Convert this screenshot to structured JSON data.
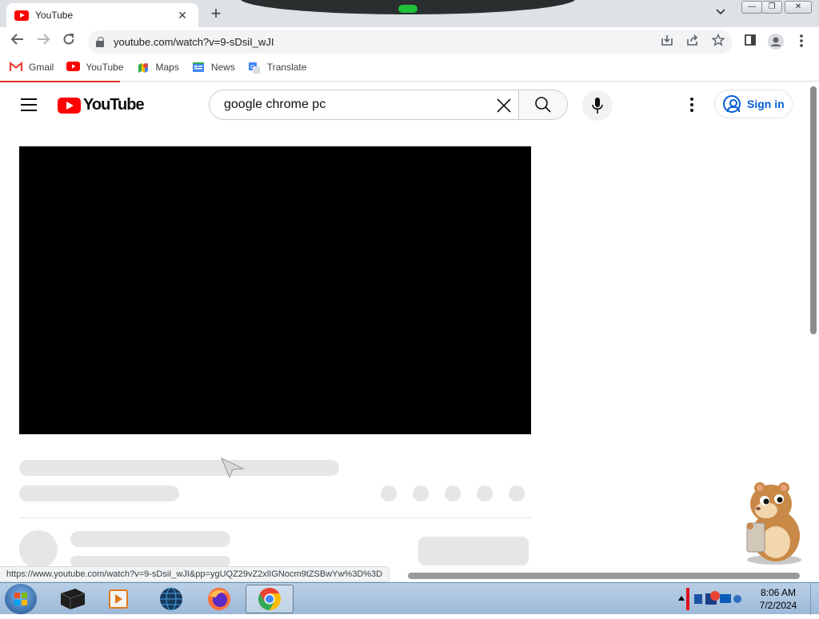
{
  "browser": {
    "tab": {
      "title": "YouTube",
      "close_glyph": "✕"
    },
    "new_tab_glyph": "+",
    "tab_menu_glyph": "⌄",
    "window_controls": {
      "minimize": "—",
      "maximize": "❐",
      "close": "✕"
    },
    "nav": {
      "back": "←",
      "forward": "→",
      "reload": "↻"
    },
    "address": {
      "url": "youtube.com/watch?v=9-sDsiI_wJI"
    },
    "address_icons": [
      "install-icon",
      "share-icon",
      "star-icon"
    ],
    "toolbar_icons": [
      "side-panel-icon",
      "profile-icon",
      "menu-icon"
    ],
    "bookmarks": [
      {
        "label": "Gmail",
        "icon": "gmail-icon"
      },
      {
        "label": "YouTube",
        "icon": "youtube-icon"
      },
      {
        "label": "Maps",
        "icon": "maps-icon"
      },
      {
        "label": "News",
        "icon": "news-icon"
      },
      {
        "label": "Translate",
        "icon": "translate-icon"
      }
    ],
    "status_url": "https://www.youtube.com/watch?v=9-sDsiI_wJI&pp=ygUQZ29vZ2xlIGNocm9tZSBwYw%3D%3D"
  },
  "youtube": {
    "logo_text": "YouTube",
    "search": {
      "value": "google chrome pc",
      "placeholder": "Search"
    },
    "signin_label": "Sign in"
  },
  "taskbar": {
    "apps": [
      "terminal-icon",
      "media-player-icon",
      "network-globe-icon",
      "firefox-icon",
      "chrome-icon"
    ],
    "time": "8:06 AM",
    "date": "7/2/2024"
  },
  "colors": {
    "youtube_red": "#ff0000",
    "link_blue": "#065fd4",
    "skeleton": "#e6e6e6",
    "loading_bar": "#d93025"
  }
}
